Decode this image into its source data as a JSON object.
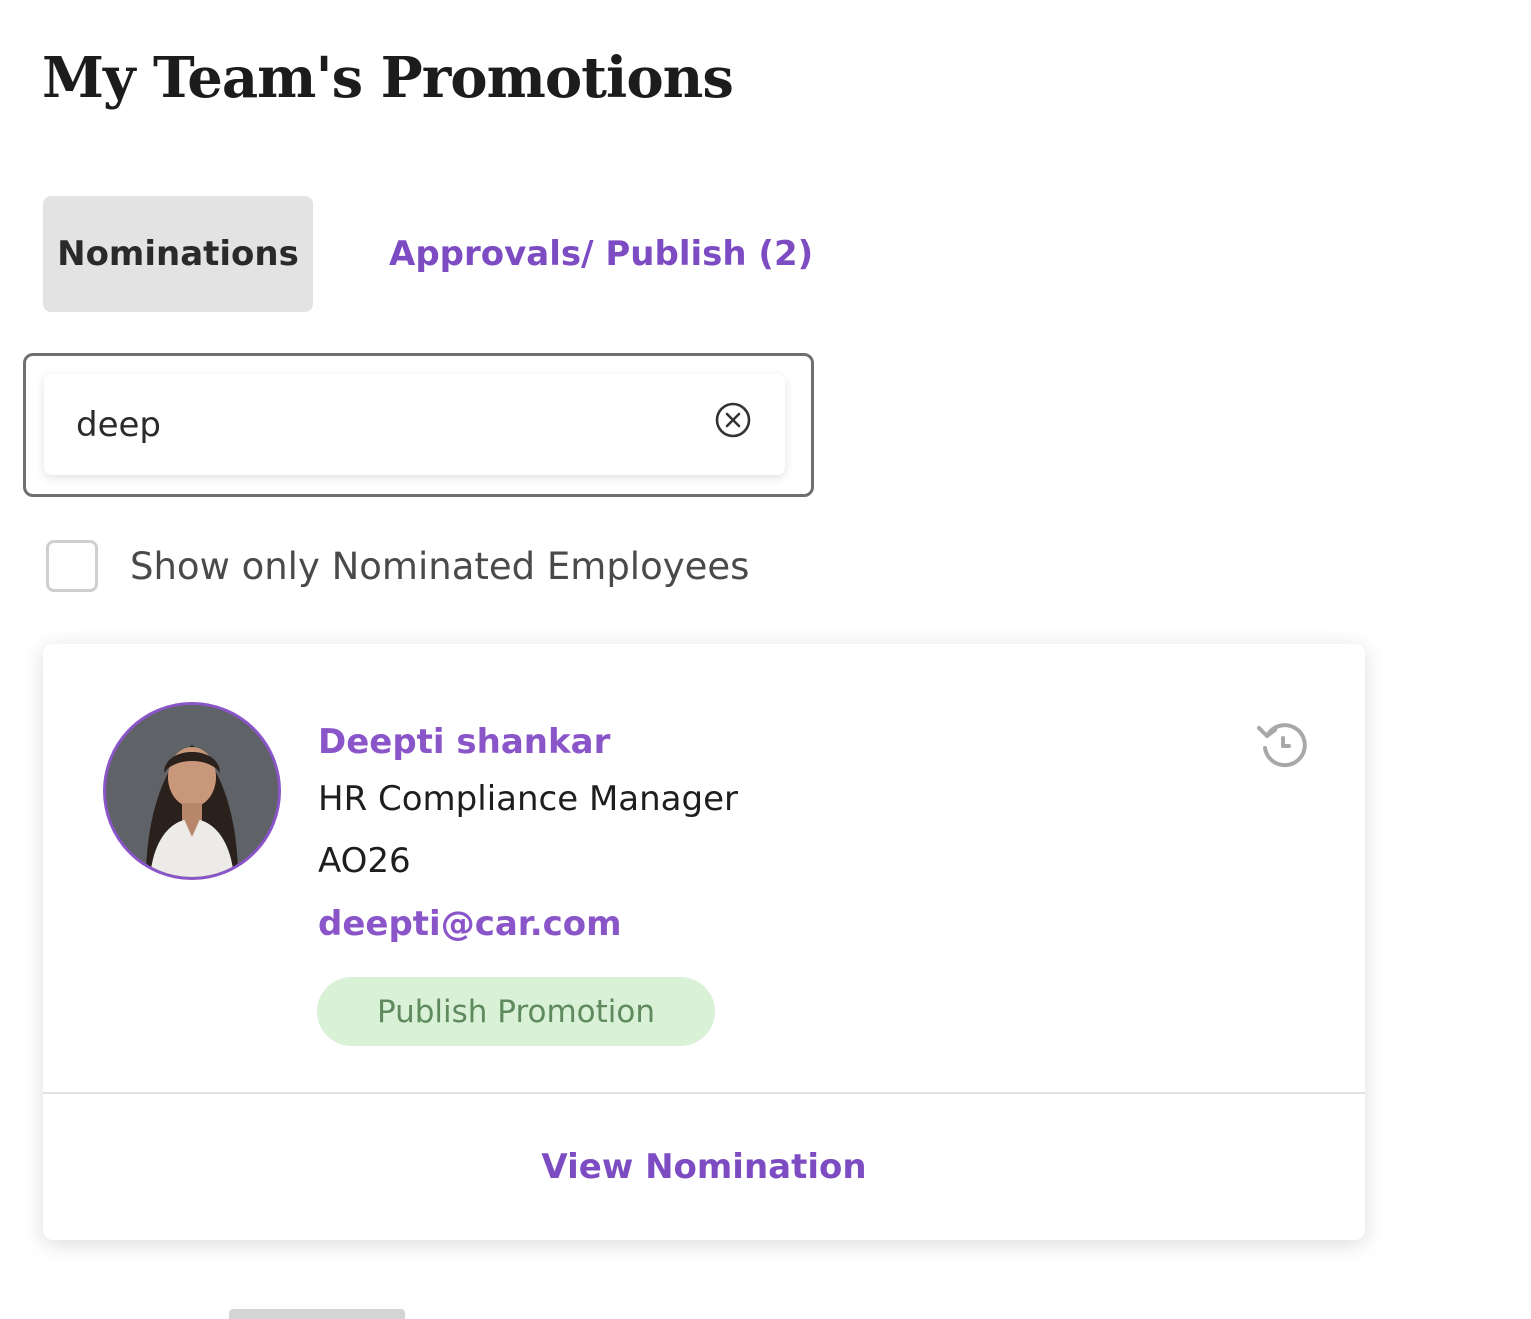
{
  "page": {
    "title": "My Team's Promotions"
  },
  "tabs": [
    {
      "label": "Nominations",
      "active": true
    },
    {
      "label": "Approvals/ Publish (2)",
      "active": false
    }
  ],
  "search": {
    "value": "deep",
    "placeholder": ""
  },
  "filter": {
    "label": "Show only Nominated Employees",
    "checked": false
  },
  "employee_card": {
    "name": "Deepti shankar",
    "title": "HR Compliance Manager",
    "employee_id": "AO26",
    "email": "deepti@car.com",
    "status": "Publish Promotion",
    "action_label": "View Nomination"
  },
  "icons": {
    "clear": "clear-circle-x-icon",
    "history": "history-icon"
  },
  "colors": {
    "accent": "#7d4cc3",
    "active_tab_bg": "#e3e3e3",
    "status_bg": "#d9f1d6",
    "status_text": "#5e8a5d"
  }
}
